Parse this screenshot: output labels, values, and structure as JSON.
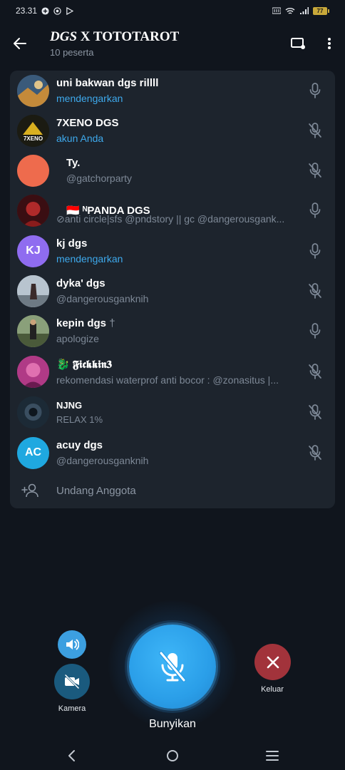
{
  "status_bar": {
    "time": "23.31",
    "battery": "77"
  },
  "header": {
    "title_italic": "DGS",
    "title_rest": " X TOTOTAROT",
    "subtitle": "10 peserta"
  },
  "participants": [
    {
      "name": "uni bakwan dgs rillll",
      "status": "mendengarkan",
      "status_active": true,
      "mic": "mic-icon",
      "avatar_color": "#3a5a7a"
    },
    {
      "name": "7XENO DGS",
      "status": "akun Anda",
      "status_active": true,
      "mic": "mic-off-icon",
      "avatar_color": "#1b1b12"
    },
    {
      "name": "Ty.",
      "status": "@gatchorparty",
      "status_active": false,
      "mic": "mic-off-icon",
      "avatar_color": "#ee6b4d"
    },
    {
      "name": "🇮🇩 ᴺPANDA DGS",
      "status": "⊘anti circle|sfs @pndstory || gc @dangerousgank...",
      "status_active": false,
      "mic": "mic-icon",
      "avatar_color": "#6b1a1a"
    },
    {
      "name": "kj dgs",
      "initials": "KJ",
      "status": "mendengarkan",
      "status_active": true,
      "mic": "mic-icon",
      "avatar_color": "#8f6cf0"
    },
    {
      "name": "dyka' dgs",
      "status": "@dangerousganknih",
      "status_active": false,
      "mic": "mic-off-icon",
      "avatar_color": "#9aa7b3"
    },
    {
      "name": "kepin dgs",
      "status": "apologize",
      "status_active": false,
      "mic": "mic-icon",
      "avatar_color": "#5d6a4a"
    },
    {
      "name": "🐉 𝕱𝖎𝖈𝖐𝖐𝖎𝖓𝟑",
      "status": "rekomendasi waterprof anti bocor : @zonasitus |...",
      "status_active": false,
      "mic": "mic-off-icon",
      "avatar_color": "#b03a86"
    },
    {
      "name": "NJNG",
      "status": "RELAX 1%",
      "status_active": false,
      "mic": "mic-off-icon",
      "avatar_color": "#22313e"
    },
    {
      "name": "acuy dgs",
      "initials": "AC",
      "status": "@dangerousganknih",
      "status_active": false,
      "mic": "mic-off-icon",
      "avatar_color": "#1fa8e0"
    }
  ],
  "invite": {
    "label": "Undang Anggota"
  },
  "controls": {
    "camera_label": "Kamera",
    "main_label": "Bunyikan",
    "leave_label": "Keluar"
  },
  "colors": {
    "background": "#10151d",
    "panel": "#1d242d",
    "accent": "#3ea9ec",
    "leave": "#a2333b"
  }
}
